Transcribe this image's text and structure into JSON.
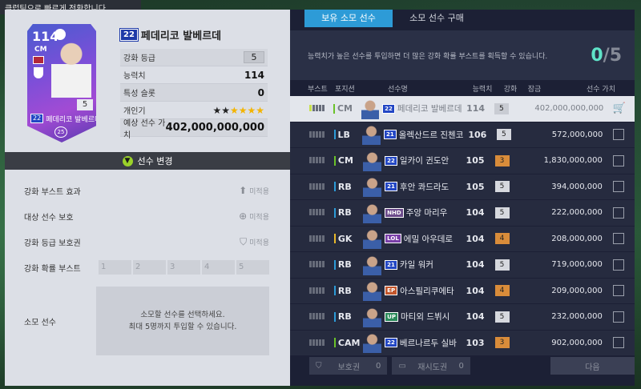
{
  "tooltip": "클럽팀으로 빠르게 전환합니다.",
  "card": {
    "ovr": "114",
    "position": "CM",
    "grade": "5",
    "season": "22",
    "name": "페데리코 발베르데",
    "level": "25"
  },
  "player": {
    "season": "22",
    "name": "페데리코 발베르데"
  },
  "stats": {
    "grade_label": "강화 등급",
    "grade_value": "5",
    "ovr_label": "능력치",
    "ovr_value": "114",
    "trait_label": "특성 슬롯",
    "trait_value": "0",
    "popularity_label": "개인기",
    "popularity_value": "2",
    "popularity_filled": "★★",
    "popularity_empty": "★★★★",
    "price_label": "예상 선수 가치",
    "price_value": "402,000,000,000"
  },
  "change_button": "선수 변경",
  "boost_rows": {
    "effect_label": "강화 부스트 효과",
    "protect_label": "대상 선수 보호",
    "grade_protect_label": "강화 등급 보호권",
    "unused": "미적용",
    "prob_label": "강화 확률 부스트",
    "slots": [
      "1",
      "2",
      "3",
      "4",
      "5"
    ]
  },
  "material": {
    "label": "소모 선수",
    "line1": "소모할 선수를 선택하세요.",
    "line2": "최대 5명까지 투입할 수 있습니다."
  },
  "tabs": [
    "보유 소모 선수",
    "소모 선수 구매"
  ],
  "info": {
    "message": "능력치가 높은 선수를 투입하면 더 많은 강화 확률 부스트를 획득할 수 있습니다.",
    "count": "0",
    "max": "/5"
  },
  "headers": {
    "boost": "부스트",
    "position": "포지션",
    "name": "선수명",
    "ovr": "능력치",
    "grade": "강화",
    "lock": "잠금",
    "value": "선수 가치"
  },
  "players": [
    {
      "boost": 1,
      "pos": "CM",
      "posColor": "#6ac229",
      "season": "22",
      "seasonColor": "#2246c4",
      "name": "페데리코 발베르데",
      "ovr": "114",
      "grade": "5",
      "gradeColor": "#c9ccd3",
      "value": "402,000,000,000",
      "selected": true
    },
    {
      "boost": 0,
      "pos": "LB",
      "posColor": "#2d9bd7",
      "season": "21",
      "seasonColor": "#2246c4",
      "name": "올렉산드르 진첸코",
      "ovr": "106",
      "grade": "5",
      "gradeColor": "#d6d8de",
      "value": "572,000,000",
      "selected": false
    },
    {
      "boost": 0,
      "pos": "CM",
      "posColor": "#6ac229",
      "season": "22",
      "seasonColor": "#2246c4",
      "name": "일카이 귄도안",
      "ovr": "105",
      "grade": "3",
      "gradeColor": "#d98c3a",
      "value": "1,830,000,000",
      "selected": false
    },
    {
      "boost": 0,
      "pos": "RB",
      "posColor": "#2d9bd7",
      "season": "21",
      "seasonColor": "#2246c4",
      "name": "후안 콰드라도",
      "ovr": "105",
      "grade": "5",
      "gradeColor": "#d6d8de",
      "value": "394,000,000",
      "selected": false
    },
    {
      "boost": 0,
      "pos": "RB",
      "posColor": "#2d9bd7",
      "season": "NHD",
      "seasonColor": "#6b4a8a",
      "name": "주앙 마리우",
      "ovr": "104",
      "grade": "5",
      "gradeColor": "#d6d8de",
      "value": "222,000,000",
      "selected": false
    },
    {
      "boost": 0,
      "pos": "GK",
      "posColor": "#e8b82a",
      "season": "LOL",
      "seasonColor": "#7a3fa8",
      "name": "에밀 아우데로",
      "ovr": "104",
      "grade": "4",
      "gradeColor": "#d98c3a",
      "value": "208,000,000",
      "selected": false
    },
    {
      "boost": 0,
      "pos": "RB",
      "posColor": "#2d9bd7",
      "season": "21",
      "seasonColor": "#2246c4",
      "name": "카일 워커",
      "ovr": "104",
      "grade": "5",
      "gradeColor": "#d6d8de",
      "value": "719,000,000",
      "selected": false
    },
    {
      "boost": 0,
      "pos": "RB",
      "posColor": "#2d9bd7",
      "season": "EP",
      "seasonColor": "#c2552b",
      "name": "아스필리쿠에타",
      "ovr": "104",
      "grade": "4",
      "gradeColor": "#d98c3a",
      "value": "209,000,000",
      "selected": false
    },
    {
      "boost": 0,
      "pos": "RB",
      "posColor": "#2d9bd7",
      "season": "UP",
      "seasonColor": "#2a8a5a",
      "name": "마티외 드뷔시",
      "ovr": "104",
      "grade": "5",
      "gradeColor": "#d6d8de",
      "value": "232,000,000",
      "selected": false
    },
    {
      "boost": 0,
      "pos": "CAM",
      "posColor": "#6ac229",
      "season": "22",
      "seasonColor": "#2246c4",
      "name": "베르나르두 실바",
      "ovr": "103",
      "grade": "3",
      "gradeColor": "#d98c3a",
      "value": "902,000,000",
      "selected": false
    }
  ],
  "footer": {
    "protect": "보호권",
    "protect_count": "0",
    "retry": "재시도권",
    "retry_count": "0",
    "next": "다음"
  }
}
